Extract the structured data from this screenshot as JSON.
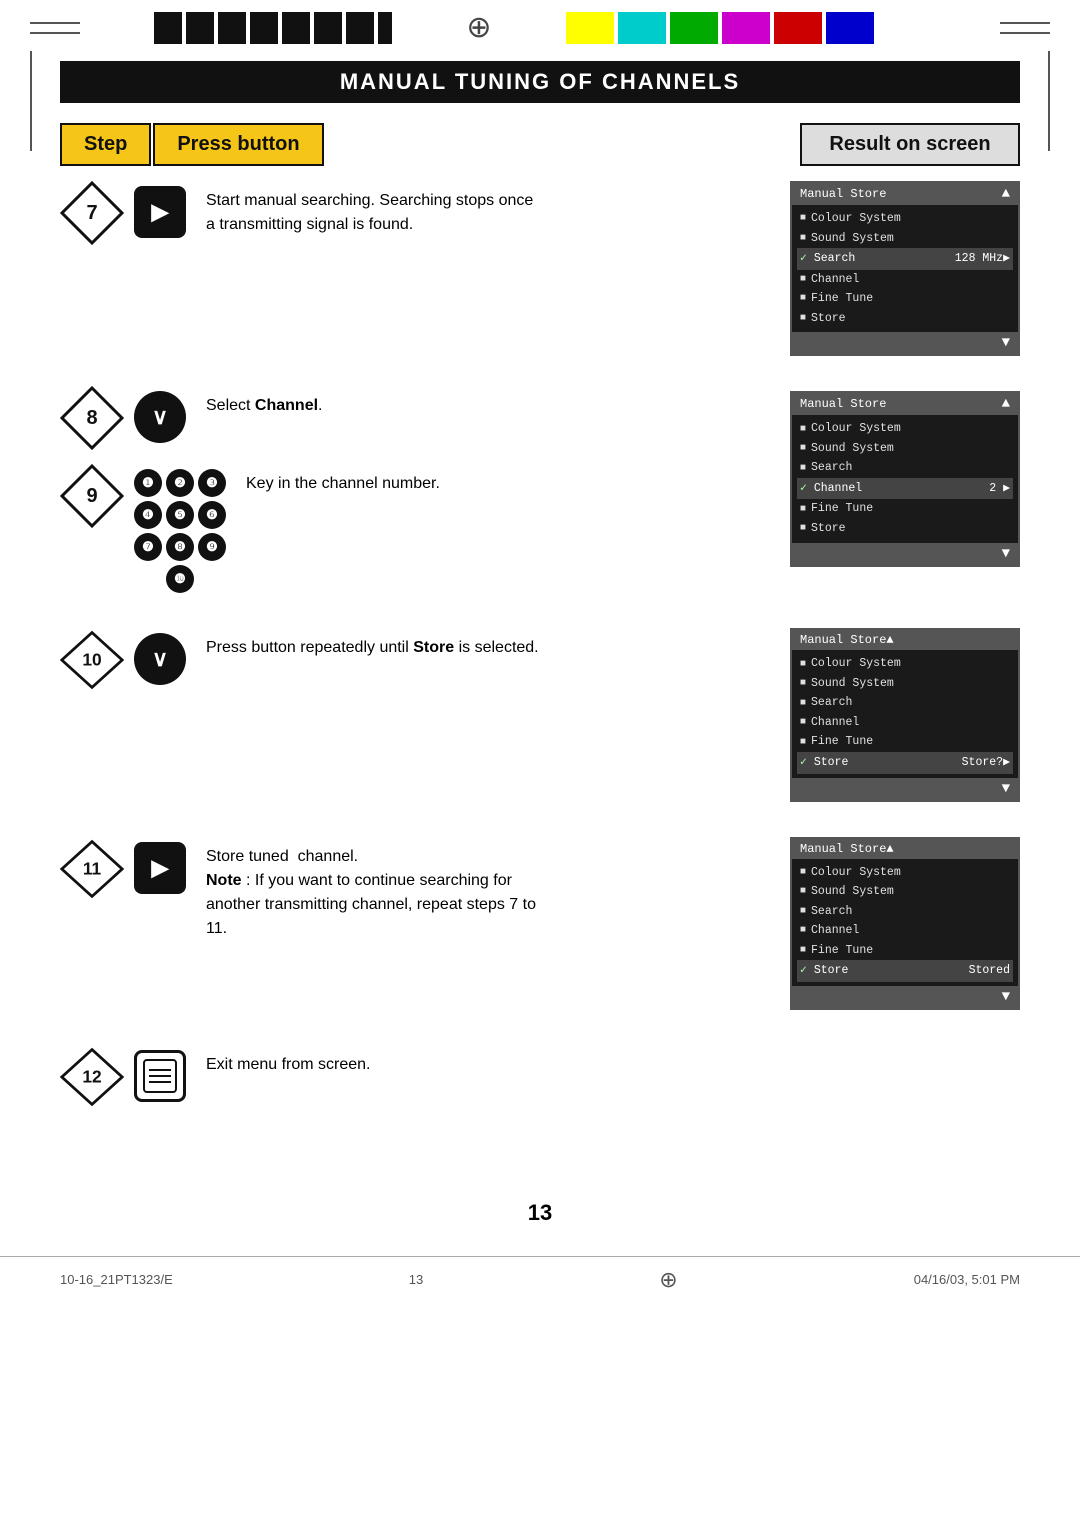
{
  "page": {
    "title": "Manual Tuning of Channels",
    "page_number": "13",
    "footer_left": "10-16_21PT1323/E",
    "footer_center": "13",
    "footer_right": "04/16/03, 5:01 PM"
  },
  "header": {
    "step_label": "Step",
    "press_button_label": "Press button",
    "result_label": "Result on screen"
  },
  "steps": [
    {
      "number": "7",
      "button": ">",
      "button_type": "square",
      "description": "Start manual searching. Searching stops once a transmitting signal is found.",
      "screen": {
        "title": "Manual Store",
        "items": [
          "Colour System",
          "Sound System",
          "Search   128 MHz▶",
          "Channel",
          "Fine Tune",
          "Store"
        ],
        "selected": "Search",
        "selected_value": "128 MHz▶",
        "has_down_arrow": true
      }
    },
    {
      "number": "8",
      "button": "∨",
      "button_type": "circle",
      "description": "Select Channel."
    },
    {
      "number": "9",
      "button": "numpad",
      "button_type": "numpad",
      "description": "Key in the channel number.",
      "screen": {
        "title": "Manual Store",
        "items": [
          "Colour System",
          "Sound System",
          "Search",
          "Channel   2 ▶",
          "Fine Tune",
          "Store"
        ],
        "selected": "Channel",
        "selected_value": "2 ▶",
        "has_down_arrow": true
      }
    },
    {
      "number": "10",
      "button": "∨",
      "button_type": "circle",
      "description": "Press button repeatedly until Store is selected.",
      "description_bold": "Store",
      "screen": {
        "title": "Manual Store▲",
        "items": [
          "Colour System",
          "Sound System",
          "Search",
          "Channel",
          "Fine Tune",
          "Store   Store?▶"
        ],
        "selected": "Store",
        "selected_value": "Store?▶",
        "has_down_arrow": true
      }
    },
    {
      "number": "11",
      "button": ">",
      "button_type": "square",
      "description_lines": [
        "Store tuned  channel.",
        "Note : If you want to continue searching for another transmitting channel, repeat steps 7 to 11."
      ],
      "note_bold": "Note",
      "screen": {
        "title": "Manual Store▲",
        "items": [
          "Colour System",
          "Sound System",
          "Search",
          "Channel",
          "Fine Tune",
          "Store   Stored"
        ],
        "selected": "Store",
        "selected_value": "Stored",
        "has_down_arrow": true
      }
    },
    {
      "number": "12",
      "button": "⊞",
      "button_type": "menu",
      "description": "Exit menu from screen."
    }
  ],
  "colors": {
    "black_bars": [
      "#111111",
      "#222222",
      "#333333",
      "#444444",
      "#555555",
      "#666666",
      "#777777"
    ],
    "color_bars": [
      "#ffff00",
      "#00ffff",
      "#00cc00",
      "#ff00ff",
      "#ff0000",
      "#0000ff",
      "#ff6600",
      "#ffffff"
    ]
  },
  "numpad": [
    "1",
    "2",
    "3",
    "4",
    "5",
    "6",
    "7",
    "8",
    "9",
    "0"
  ]
}
